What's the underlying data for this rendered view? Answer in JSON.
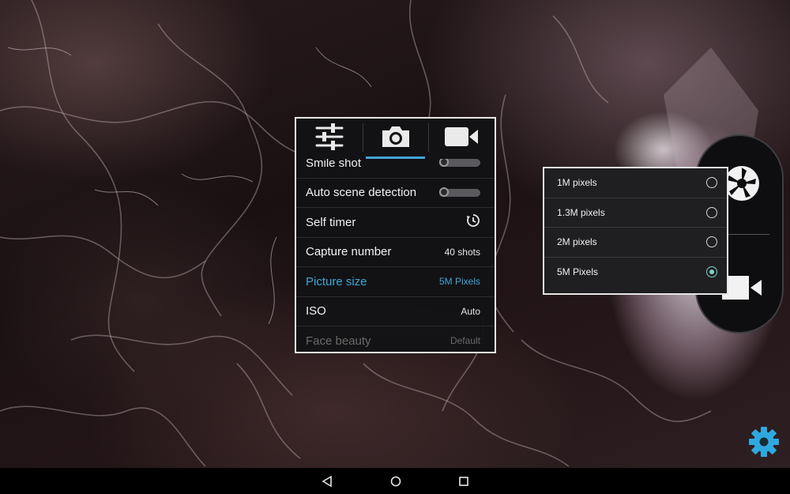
{
  "tabs": [
    {
      "icon": "sliders-icon"
    },
    {
      "icon": "camera-icon",
      "active": true
    },
    {
      "icon": "video-camera-icon"
    }
  ],
  "settings": {
    "smile_shot": {
      "label": "Smile shot"
    },
    "auto_scene": {
      "label": "Auto scene detection"
    },
    "self_timer": {
      "label": "Self timer",
      "icon": "timer-icon"
    },
    "capture_number": {
      "label": "Capture number",
      "value": "40 shots"
    },
    "picture_size": {
      "label": "Picture size",
      "value": "5M Pixels"
    },
    "iso": {
      "label": "ISO",
      "value": "Auto"
    },
    "face_beauty": {
      "label": "Face beauty",
      "value": "Default"
    }
  },
  "picture_size_options": [
    {
      "label": "1M pixels",
      "checked": false
    },
    {
      "label": "1.3M pixels",
      "checked": false
    },
    {
      "label": "2M pixels",
      "checked": false
    },
    {
      "label": "5M Pixels",
      "checked": true
    }
  ],
  "colors": {
    "accent": "#41a6d6",
    "radio_checked": "#7ed3c4",
    "gear": "#2fa8df"
  },
  "nav": [
    "back-icon",
    "home-icon",
    "recents-icon"
  ]
}
